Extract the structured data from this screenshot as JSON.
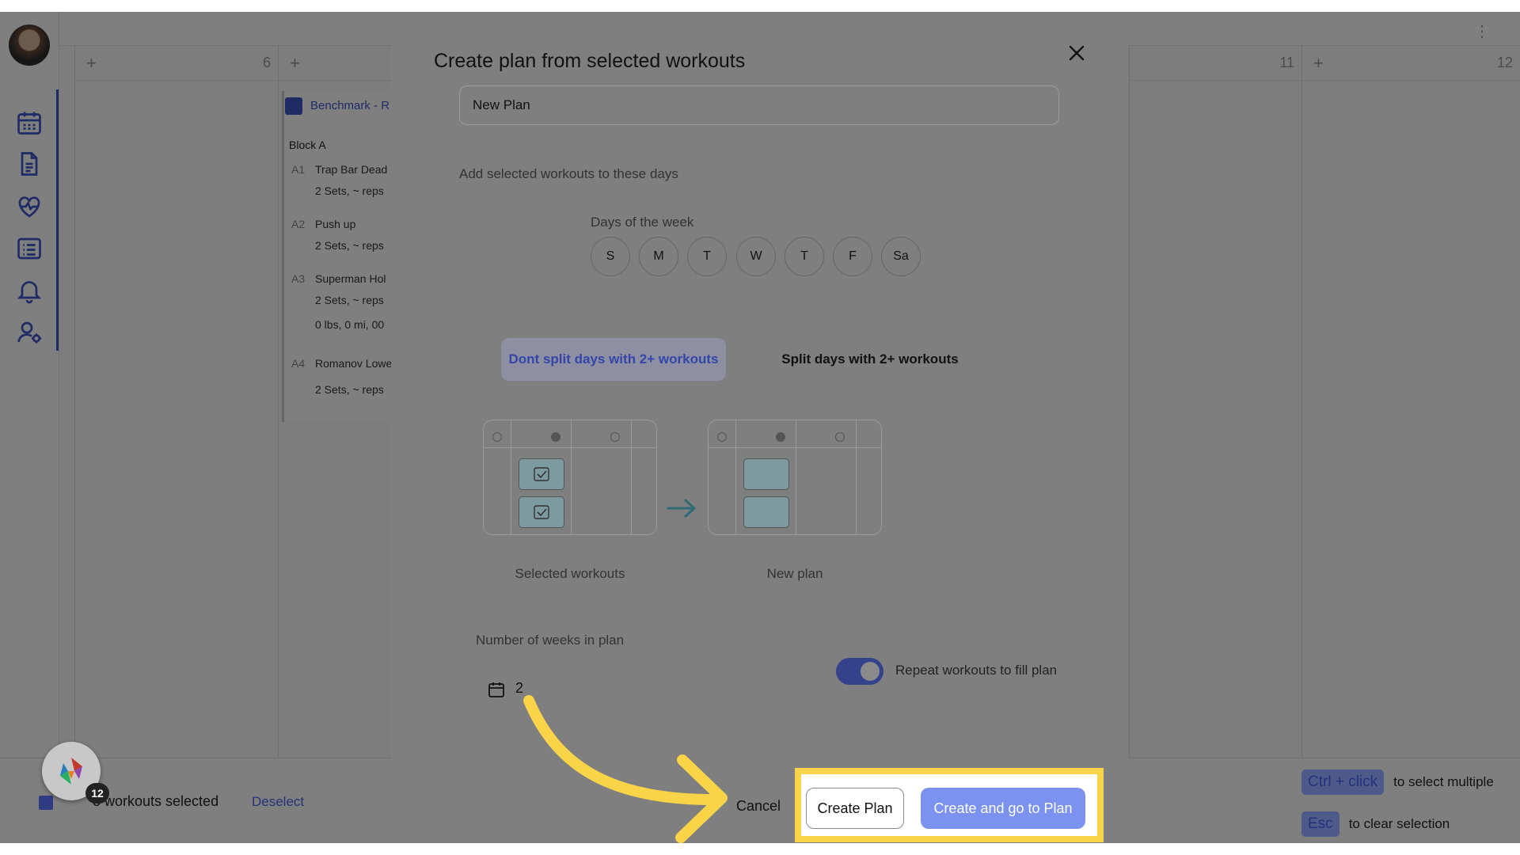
{
  "background": {
    "column_numbers": [
      "6",
      "11",
      "12"
    ],
    "workout": {
      "title": "Benchmark - R",
      "block": "Block A",
      "exercises": [
        {
          "num": "A1",
          "name": "Trap Bar Dead",
          "detail": "2 Sets, ~ reps"
        },
        {
          "num": "A2",
          "name": "Push up",
          "detail": "2 Sets, ~ reps"
        },
        {
          "num": "A3",
          "name": "Superman Hol",
          "detail": "2 Sets, ~ reps",
          "extra": "0 lbs, 0 mi, 00"
        },
        {
          "num": "A4",
          "name": "Romanov Lowe",
          "detail": "2 Sets, ~ reps"
        }
      ]
    },
    "bottom_bar": {
      "selected_text": "3 workouts selected",
      "deselect_label": "Deselect",
      "hints": [
        {
          "key": "Ctrl + click",
          "text": "to select multiple"
        },
        {
          "key": "Esc",
          "text": "to clear selection"
        }
      ]
    },
    "fab_badge": "12"
  },
  "sidebar": {
    "icons": [
      "calendar-icon",
      "document-icon",
      "heart-pulse-icon",
      "list-icon",
      "bell-icon",
      "user-settings-icon"
    ]
  },
  "modal": {
    "title": "Create plan from selected workouts",
    "plan_name_value": "New Plan",
    "add_days_label": "Add selected workouts to these days",
    "days_of_week_label": "Days of the week",
    "days": [
      "S",
      "M",
      "T",
      "W",
      "T",
      "F",
      "Sa"
    ],
    "split_options": {
      "selected": "Dont split days with 2+ workouts",
      "other": "Split days with 2+ workouts"
    },
    "illustration": {
      "left_caption": "Selected workouts",
      "right_caption": "New plan"
    },
    "weeks_label": "Number of weeks in plan",
    "weeks_value": "2",
    "repeat_label": "Repeat workouts to fill plan",
    "repeat_enabled": true,
    "cancel_label": "Cancel",
    "create_label": "Create Plan",
    "create_go_label": "Create and go to Plan"
  },
  "colors": {
    "accent": "#3e57c9",
    "primary_button": "#7b92f0",
    "highlight": "#f9d448"
  }
}
